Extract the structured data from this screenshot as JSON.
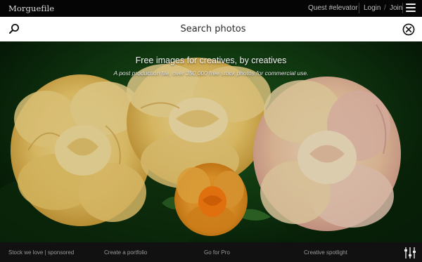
{
  "header": {
    "logo": "Morguefile",
    "quest": "Quest #elevator",
    "login": "Login",
    "slash": "/",
    "join": "Join",
    "menu_icon": "hamburger-menu-icon"
  },
  "search": {
    "placeholder": "Search photos",
    "search_icon": "search-icon",
    "clear_icon": "close-circle-icon"
  },
  "hero": {
    "tagline": "Free images for creatives, by creatives",
    "subline": "A post production file, over 350,000 free stock photos for commercial use."
  },
  "footer": {
    "links": [
      "Stock we love | sponsored",
      "Create a portfolio",
      "Go for Pro",
      "Creative spotlight"
    ],
    "filter_icon": "filter-sliders-icon"
  },
  "colors": {
    "topbar": "#050505",
    "searchbar": "#ffffff",
    "rose": "#f3d27a",
    "center_rose": "#f28b1a",
    "foliage": "#123e12"
  }
}
